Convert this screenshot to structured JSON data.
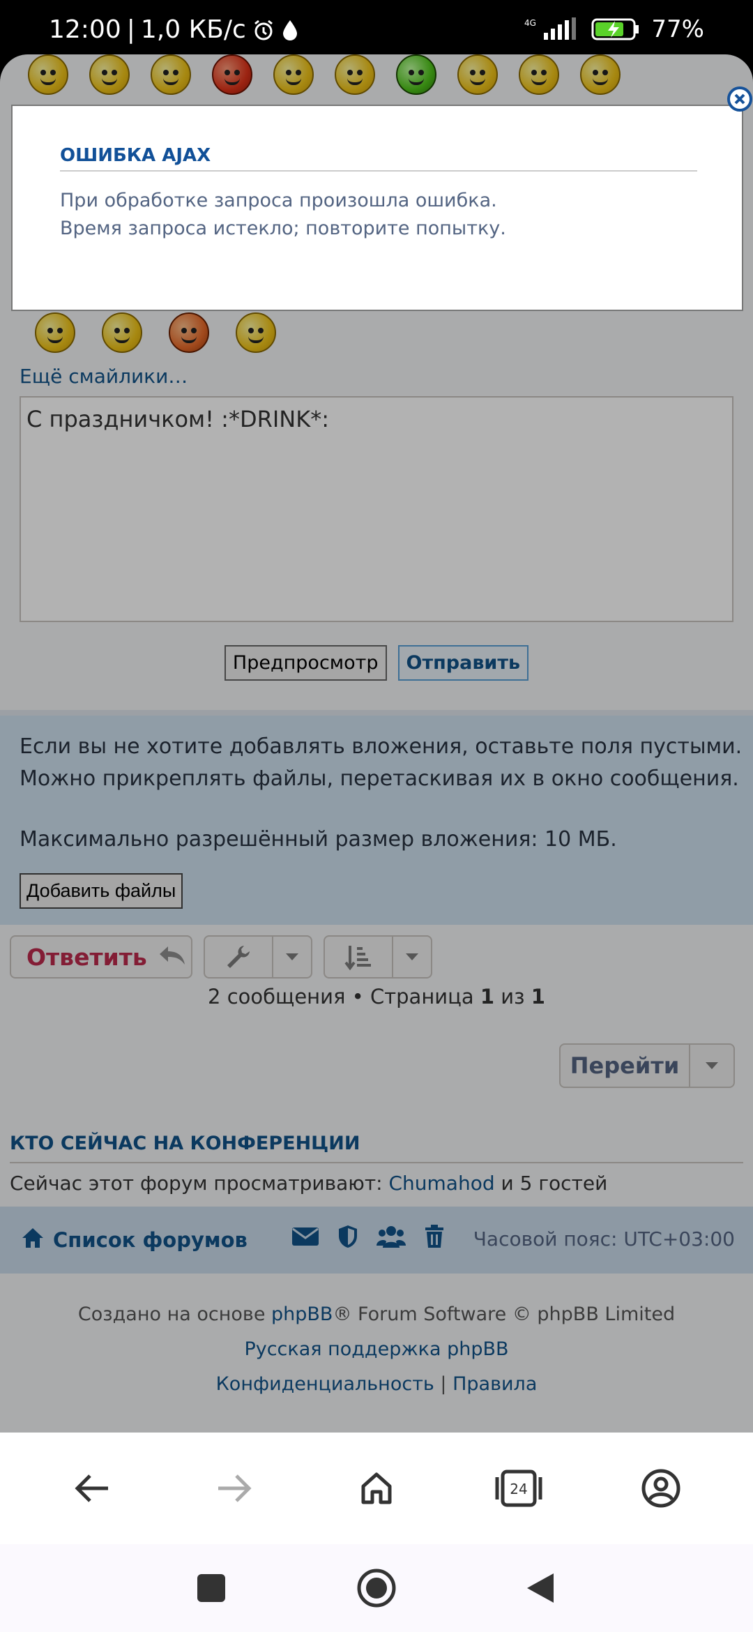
{
  "status_bar": {
    "time": "12:00",
    "speed": "1,0 КБ/с",
    "network": "4G",
    "battery": "77%"
  },
  "emoticons": {
    "top_row": [
      "smiley",
      "smiley",
      "smiley",
      "smiley-red",
      "smiley",
      "smiley",
      "smiley-green",
      "smiley",
      "smiley",
      "smiley"
    ],
    "second_row": [
      "smiley",
      "smiley",
      "smiley-orange",
      "smiley"
    ],
    "more_link": "Ещё смайлики…"
  },
  "message": {
    "text": "С праздничком!  :*DRINK*:"
  },
  "buttons": {
    "preview": "Предпросмотр",
    "submit": "Отправить"
  },
  "attachments": {
    "line1": "Если вы не хотите добавлять вложения, оставьте поля пустыми.",
    "line2": "Можно прикреплять файлы, перетаскивая их в окно сообщения.",
    "max_size": "Максимально разрешённый размер вложения: 10 МБ.",
    "add_button": "Добавить файлы"
  },
  "actions": {
    "reply": "Ответить"
  },
  "pagination": {
    "posts": "2 сообщения",
    "separator": " • Страница ",
    "current": "1",
    "of": " из ",
    "total": "1"
  },
  "jump": {
    "label": "Перейти"
  },
  "who_online": {
    "title": "КТО СЕЙЧАС НА КОНФЕРЕНЦИИ",
    "prefix": "Сейчас этот форум просматривают: ",
    "user": "Chumahod",
    "suffix": " и 5 гостей"
  },
  "footer_nav": {
    "forum_list": "Список форумов",
    "timezone": "Часовой пояс: UTC+03:00"
  },
  "credits": {
    "prefix": "Создано на основе ",
    "phpbb": "phpBB",
    "suffix": "® Forum Software © phpBB Limited",
    "russian_support": "Русская поддержка phpBB",
    "privacy": "Конфиденциальность",
    "sep": " | ",
    "rules": "Правила"
  },
  "alert": {
    "title": "ОШИБКА AJAX",
    "line1": "При обработке запроса произошла ошибка.",
    "line2": "Время запроса истекло; повторите попытку."
  },
  "browser": {
    "tab_count": "24"
  },
  "colors": {
    "link": "#105289",
    "reply": "#BC2A4D",
    "attach_panel": "#CFE1F0",
    "footer_bar": "#CADCEB"
  }
}
